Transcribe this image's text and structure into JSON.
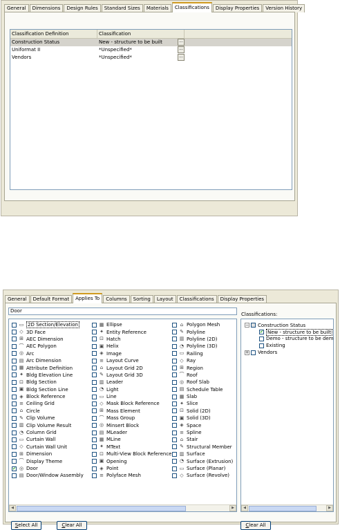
{
  "top_dialog": {
    "tabs": [
      "General",
      "Dimensions",
      "Design Rules",
      "Standard Sizes",
      "Materials",
      "Classifications",
      "Display Properties",
      "Version History"
    ],
    "active_tab": "Classifications",
    "grid": {
      "headers": [
        "Classification Definition",
        "Classification"
      ],
      "rows": [
        {
          "definition": "Construction Status",
          "classification": "New - structure to be built",
          "button": "..."
        },
        {
          "definition": "Uniformat II",
          "classification": "*Unspecified*",
          "button": "..."
        },
        {
          "definition": "Vendors",
          "classification": "*Unspecified*",
          "button": "..."
        }
      ]
    }
  },
  "bottom_dialog": {
    "tabs": [
      "General",
      "Default Format",
      "Applies To",
      "Columns",
      "Sorting",
      "Layout",
      "Classifications",
      "Display Properties"
    ],
    "active_tab": "Applies To",
    "filter_value": "Door",
    "object_columns": [
      [
        {
          "label": "2D Section/Elevation",
          "icon": "section-icon",
          "checked": false,
          "selected": true
        },
        {
          "label": "3D Face",
          "icon": "face-icon",
          "checked": false
        },
        {
          "label": "AEC Dimension",
          "icon": "dimension-icon",
          "checked": false
        },
        {
          "label": "AEC Polygon",
          "icon": "polygon-icon",
          "checked": false
        },
        {
          "label": "Arc",
          "icon": "arc-icon",
          "checked": false
        },
        {
          "label": "Arc Dimension",
          "icon": "arc-dimension-icon",
          "checked": false
        },
        {
          "label": "Attribute Definition",
          "icon": "attribute-icon",
          "checked": false
        },
        {
          "label": "Bldg Elevation Line",
          "icon": "elevation-line-icon",
          "checked": false
        },
        {
          "label": "Bldg Section",
          "icon": "bldg-section-icon",
          "checked": false
        },
        {
          "label": "Bldg Section Line",
          "icon": "section-line-icon",
          "checked": false
        },
        {
          "label": "Block Reference",
          "icon": "block-icon",
          "checked": false
        },
        {
          "label": "Ceiling Grid",
          "icon": "ceiling-grid-icon",
          "checked": false
        },
        {
          "label": "Circle",
          "icon": "circle-icon",
          "checked": false
        },
        {
          "label": "Clip Volume",
          "icon": "clip-volume-icon",
          "checked": false
        },
        {
          "label": "Clip Volume Result",
          "icon": "clip-result-icon",
          "checked": false
        },
        {
          "label": "Column Grid",
          "icon": "column-grid-icon",
          "checked": false
        },
        {
          "label": "Curtain Wall",
          "icon": "curtain-wall-icon",
          "checked": false
        },
        {
          "label": "Curtain Wall Unit",
          "icon": "curtain-unit-icon",
          "checked": false
        },
        {
          "label": "Dimension",
          "icon": "dim-icon",
          "checked": false
        },
        {
          "label": "Display Theme",
          "icon": "theme-icon",
          "checked": false
        },
        {
          "label": "Door",
          "icon": "door-icon",
          "checked": true
        },
        {
          "label": "Door/Window Assembly",
          "icon": "assembly-icon",
          "checked": false
        }
      ],
      [
        {
          "label": "Ellipse",
          "icon": "ellipse-icon",
          "checked": false
        },
        {
          "label": "Entity Reference",
          "icon": "entity-icon",
          "checked": false
        },
        {
          "label": "Hatch",
          "icon": "hatch-icon",
          "checked": false
        },
        {
          "label": "Helix",
          "icon": "helix-icon",
          "checked": false
        },
        {
          "label": "Image",
          "icon": "image-icon",
          "checked": false
        },
        {
          "label": "Layout Curve",
          "icon": "layout-curve-icon",
          "checked": false
        },
        {
          "label": "Layout Grid 2D",
          "icon": "grid2d-icon",
          "checked": false
        },
        {
          "label": "Layout Grid 3D",
          "icon": "grid3d-icon",
          "checked": false
        },
        {
          "label": "Leader",
          "icon": "leader-icon",
          "checked": false
        },
        {
          "label": "Light",
          "icon": "light-icon",
          "checked": false
        },
        {
          "label": "Line",
          "icon": "line-icon",
          "checked": false
        },
        {
          "label": "Mask Block Reference",
          "icon": "mask-icon",
          "checked": false
        },
        {
          "label": "Mass Element",
          "icon": "mass-element-icon",
          "checked": false
        },
        {
          "label": "Mass Group",
          "icon": "mass-group-icon",
          "checked": false
        },
        {
          "label": "Minsert Block",
          "icon": "minsert-icon",
          "checked": false
        },
        {
          "label": "MLeader",
          "icon": "mleader-icon",
          "checked": false
        },
        {
          "label": "MLine",
          "icon": "mline-icon",
          "checked": false
        },
        {
          "label": "MText",
          "icon": "mtext-icon",
          "checked": false
        },
        {
          "label": "Multi-View Block Reference",
          "icon": "mvblock-icon",
          "checked": false
        },
        {
          "label": "Opening",
          "icon": "opening-icon",
          "checked": false
        },
        {
          "label": "Point",
          "icon": "point-icon",
          "checked": false
        },
        {
          "label": "Polyface Mesh",
          "icon": "polyface-icon",
          "checked": false
        }
      ],
      [
        {
          "label": "Polygon Mesh",
          "icon": "polygon-mesh-icon",
          "checked": false
        },
        {
          "label": "Polyline",
          "icon": "polyline-icon",
          "checked": false
        },
        {
          "label": "Polyline (2D)",
          "icon": "polyline2d-icon",
          "checked": false
        },
        {
          "label": "Polyline (3D)",
          "icon": "polyline3d-icon",
          "checked": false
        },
        {
          "label": "Railing",
          "icon": "railing-icon",
          "checked": false
        },
        {
          "label": "Ray",
          "icon": "ray-icon",
          "checked": false
        },
        {
          "label": "Region",
          "icon": "region-icon",
          "checked": false
        },
        {
          "label": "Roof",
          "icon": "roof-icon",
          "checked": false
        },
        {
          "label": "Roof Slab",
          "icon": "roof-slab-icon",
          "checked": false
        },
        {
          "label": "Schedule Table",
          "icon": "schedule-icon",
          "checked": false
        },
        {
          "label": "Slab",
          "icon": "slab-icon",
          "checked": false
        },
        {
          "label": "Slice",
          "icon": "slice-icon",
          "checked": false
        },
        {
          "label": "Solid (2D)",
          "icon": "solid2d-icon",
          "checked": false
        },
        {
          "label": "Solid (3D)",
          "icon": "solid3d-icon",
          "checked": false
        },
        {
          "label": "Space",
          "icon": "space-icon",
          "checked": false
        },
        {
          "label": "Spline",
          "icon": "spline-icon",
          "checked": false
        },
        {
          "label": "Stair",
          "icon": "stair-icon",
          "checked": false
        },
        {
          "label": "Structural Member",
          "icon": "member-icon",
          "checked": false
        },
        {
          "label": "Surface",
          "icon": "surface-icon",
          "checked": false
        },
        {
          "label": "Surface (Extrusion)",
          "icon": "surface-extrusion-icon",
          "checked": false
        },
        {
          "label": "Surface (Planar)",
          "icon": "surface-planar-icon",
          "checked": false
        },
        {
          "label": "Surface (Revolve)",
          "icon": "surface-revolve-icon",
          "checked": false
        }
      ]
    ],
    "classifications_label": "Classifications:",
    "classification_tree": {
      "root": "Construction Status",
      "children": [
        {
          "label": "New - structure to be built",
          "checked": true,
          "selected": true
        },
        {
          "label": "Demo - structure to be demolis",
          "checked": false
        },
        {
          "label": "Existing",
          "checked": false
        }
      ],
      "other_root": "Vendors"
    },
    "buttons": {
      "select_all": {
        "mnemonic": "S",
        "rest": "elect All"
      },
      "clear_all_left": {
        "mnemonic": "C",
        "rest": "lear All"
      },
      "clear_all_right": {
        "mnemonic": "C",
        "rest": "lear All"
      }
    }
  }
}
